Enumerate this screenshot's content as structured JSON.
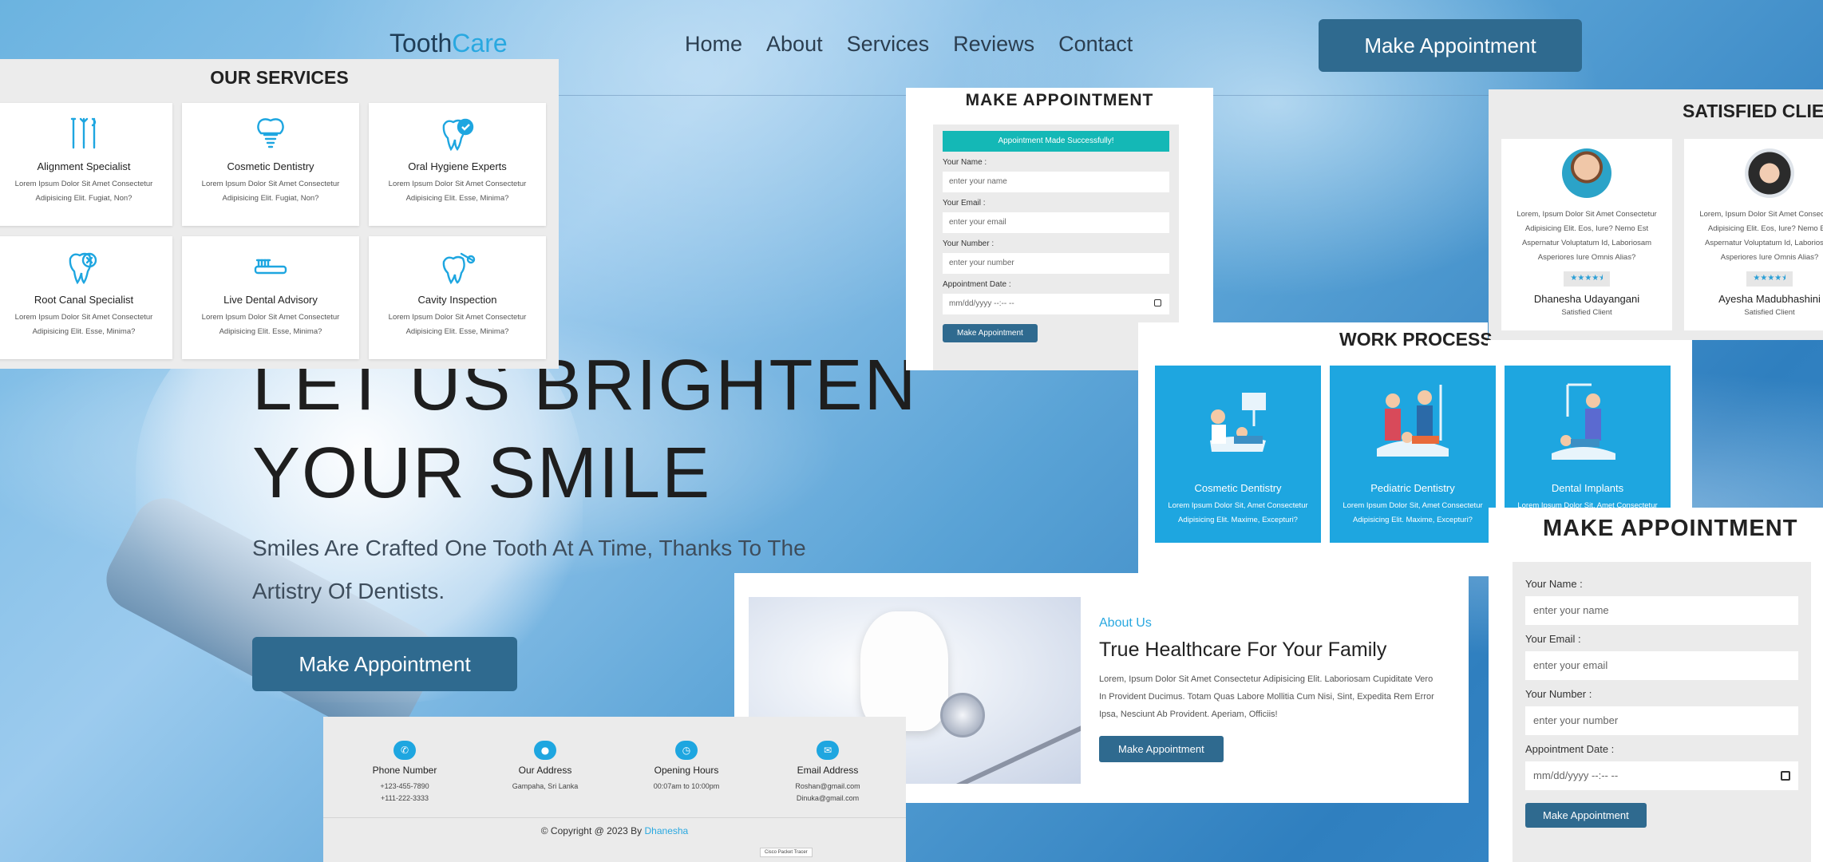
{
  "nav": {
    "logo_a": "Tooth",
    "logo_b": "Care",
    "links": [
      "Home",
      "About",
      "Services",
      "Reviews",
      "Contact"
    ],
    "cta": "Make Appointment"
  },
  "hero": {
    "title_line1": "LET US BRIGHTEN",
    "title_line2": "YOUR SMILE",
    "subtitle": "Smiles Are Crafted One Tooth At A Time, Thanks To The Artistry Of Dentists.",
    "cta": "Make Appointment"
  },
  "services": {
    "heading": "OUR SERVICES",
    "items": [
      {
        "title": "Alignment Specialist",
        "desc": "Lorem Ipsum Dolor Sit Amet Consectetur Adipisicing Elit. Fugiat, Non?"
      },
      {
        "title": "Cosmetic Dentistry",
        "desc": "Lorem Ipsum Dolor Sit Amet Consectetur Adipisicing Elit. Fugiat, Non?"
      },
      {
        "title": "Oral Hygiene Experts",
        "desc": "Lorem Ipsum Dolor Sit Amet Consectetur Adipisicing Elit. Esse, Minima?"
      },
      {
        "title": "Root Canal Specialist",
        "desc": "Lorem Ipsum Dolor Sit Amet Consectetur Adipisicing Elit. Esse, Minima?"
      },
      {
        "title": "Live Dental Advisory",
        "desc": "Lorem Ipsum Dolor Sit Amet Consectetur Adipisicing Elit. Esse, Minima?"
      },
      {
        "title": "Cavity Inspection",
        "desc": "Lorem Ipsum Dolor Sit Amet Consectetur Adipisicing Elit. Esse, Minima?"
      }
    ]
  },
  "appointment_small": {
    "heading": "MAKE APPOINTMENT",
    "success": "Appointment Made Successfully!",
    "name_label": "Your Name :",
    "name_placeholder": "enter your name",
    "email_label": "Your Email :",
    "email_placeholder": "enter your email",
    "number_label": "Your Number :",
    "number_placeholder": "enter your number",
    "date_label": "Appointment Date :",
    "date_value": "mm/dd/yyyy --:-- --",
    "submit": "Make Appointment"
  },
  "clients": {
    "heading": "SATISFIED CLIENTS",
    "items": [
      {
        "quote": "Lorem, Ipsum Dolor Sit Amet Consectetur Adipisicing Elit. Eos, Iure? Nemo Est Aspernatur Voluptatum Id, Laboriosam Asperiores Iure Omnis Alias?",
        "stars": "★★★★⯨",
        "name": "Dhanesha Udayangani",
        "role": "Satisfied Client"
      },
      {
        "quote": "Lorem, Ipsum Dolor Sit Amet Consectetur Adipisicing Elit. Eos, Iure? Nemo Est Aspernatur Voluptatum Id, Laboriosam Asperiores Iure Omnis Alias?",
        "stars": "★★★★⯨",
        "name": "Ayesha Madubhashini",
        "role": "Satisfied Client"
      }
    ]
  },
  "work": {
    "heading": "WORK PROCESS",
    "items": [
      {
        "title": "Cosmetic Dentistry",
        "desc": "Lorem Ipsum Dolor Sit, Amet Consectetur Adipisicing Elit. Maxime, Excepturi?"
      },
      {
        "title": "Pediatric Dentistry",
        "desc": "Lorem Ipsum Dolor Sit, Amet Consectetur Adipisicing Elit. Maxime, Excepturi?"
      },
      {
        "title": "Dental Implants",
        "desc": "Lorem Ipsum Dolor Sit, Amet Consectetur Adipisicing Elit. Maxime, Excepturi?"
      }
    ]
  },
  "appointment_large": {
    "heading": "MAKE APPOINTMENT",
    "name_label": "Your Name :",
    "name_placeholder": "enter your name",
    "email_label": "Your Email :",
    "email_placeholder": "enter your email",
    "number_label": "Your Number :",
    "number_placeholder": "enter your number",
    "date_label": "Appointment Date :",
    "date_value": "mm/dd/yyyy --:-- --",
    "submit": "Make Appointment"
  },
  "about": {
    "subtitle": "About Us",
    "title": "True Healthcare For Your Family",
    "desc": "Lorem, Ipsum Dolor Sit Amet Consectetur Adipisicing Elit. Laboriosam Cupiditate Vero In Provident Ducimus. Totam Quas Labore Mollitia Cum Nisi, Sint, Expedita Rem Error Ipsa, Nesciunt Ab Provident. Aperiam, Officiis!",
    "cta": "Make Appointment"
  },
  "contact": {
    "items": [
      {
        "icon": "✆",
        "title": "Phone Number",
        "line1": "+123-455-7890",
        "line2": "+111-222-3333"
      },
      {
        "icon": "●",
        "title": "Our Address",
        "line1": "Gampaha, Sri Lanka",
        "line2": ""
      },
      {
        "icon": "◷",
        "title": "Opening Hours",
        "line1": "00:07am to 10:00pm",
        "line2": ""
      },
      {
        "icon": "✉",
        "title": "Email Address",
        "line1": "Roshan@gmail.com",
        "line2": "Dinuka@gmail.com"
      }
    ],
    "copyright": "© Copyright @ 2023 By",
    "author": "Dhanesha",
    "badge": "Cisco Packet Tracer"
  },
  "colors": {
    "primary_button": "#2f6a8f",
    "accent": "#29a8e0",
    "work_card": "#1ea6e0",
    "success": "#14b8b6"
  }
}
